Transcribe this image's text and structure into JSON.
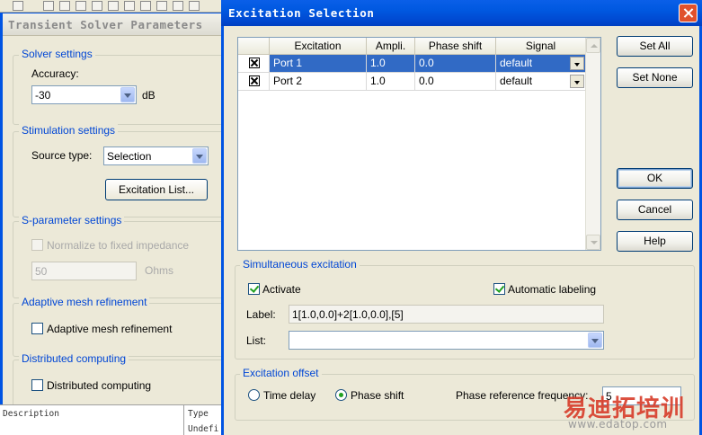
{
  "background_dialog": {
    "title": "Transient Solver Parameters",
    "solver_settings": {
      "legend": "Solver settings",
      "accuracy_label": "Accuracy:",
      "accuracy_value": "-30",
      "accuracy_unit": "dB"
    },
    "stimulation_settings": {
      "legend": "Stimulation settings",
      "source_type_label": "Source type:",
      "source_type_value": "Selection",
      "excitation_list_button": "Excitation List..."
    },
    "sparameter_settings": {
      "legend": "S-parameter settings",
      "normalize_label": "Normalize to fixed impedance",
      "impedance_value": "50",
      "impedance_unit": "Ohms"
    },
    "adaptive_mesh": {
      "legend": "Adaptive mesh refinement",
      "checkbox_label": "Adaptive mesh refinement"
    },
    "distributed_computing": {
      "legend": "Distributed computing",
      "checkbox_label": "Distributed computing"
    },
    "strip": {
      "col1": "Description",
      "col2": "Type",
      "row1_col2": "Undefi"
    }
  },
  "dialog": {
    "title": "Excitation Selection",
    "table": {
      "headers": [
        "Excitation",
        "Ampli.",
        "Phase shift",
        "Signal"
      ],
      "rows": [
        {
          "checked": true,
          "excitation": "Port 1",
          "amplitude": "1.0",
          "phase_shift": "0.0",
          "signal": "default"
        },
        {
          "checked": true,
          "excitation": "Port 2",
          "amplitude": "1.0",
          "phase_shift": "0.0",
          "signal": "default"
        }
      ]
    },
    "buttons": {
      "set_all": "Set All",
      "set_none": "Set None",
      "ok": "OK",
      "cancel": "Cancel",
      "help": "Help"
    },
    "simultaneous_excitation": {
      "legend": "Simultaneous excitation",
      "activate_label": "Activate",
      "activate_checked": true,
      "auto_label_label": "Automatic labeling",
      "auto_label_checked": true,
      "label_label": "Label:",
      "label_value": "1[1.0,0.0]+2[1.0,0.0],[5]",
      "list_label": "List:",
      "list_value": ""
    },
    "excitation_offset": {
      "legend": "Excitation offset",
      "time_delay_label": "Time delay",
      "phase_shift_label": "Phase shift",
      "selected": "phase_shift",
      "phase_ref_freq_label": "Phase reference frequency:",
      "phase_ref_freq_value": "5"
    }
  },
  "watermark": {
    "brand": "易迪拓培训",
    "url": "www.edatop.com"
  },
  "colors": {
    "titlebar_blue": "#0054e3",
    "group_label_blue": "#0046d5",
    "selection_blue": "#316ac5",
    "dialog_bg": "#ece9d8",
    "check_green": "#21a121",
    "watermark_red": "#d83c2a"
  }
}
